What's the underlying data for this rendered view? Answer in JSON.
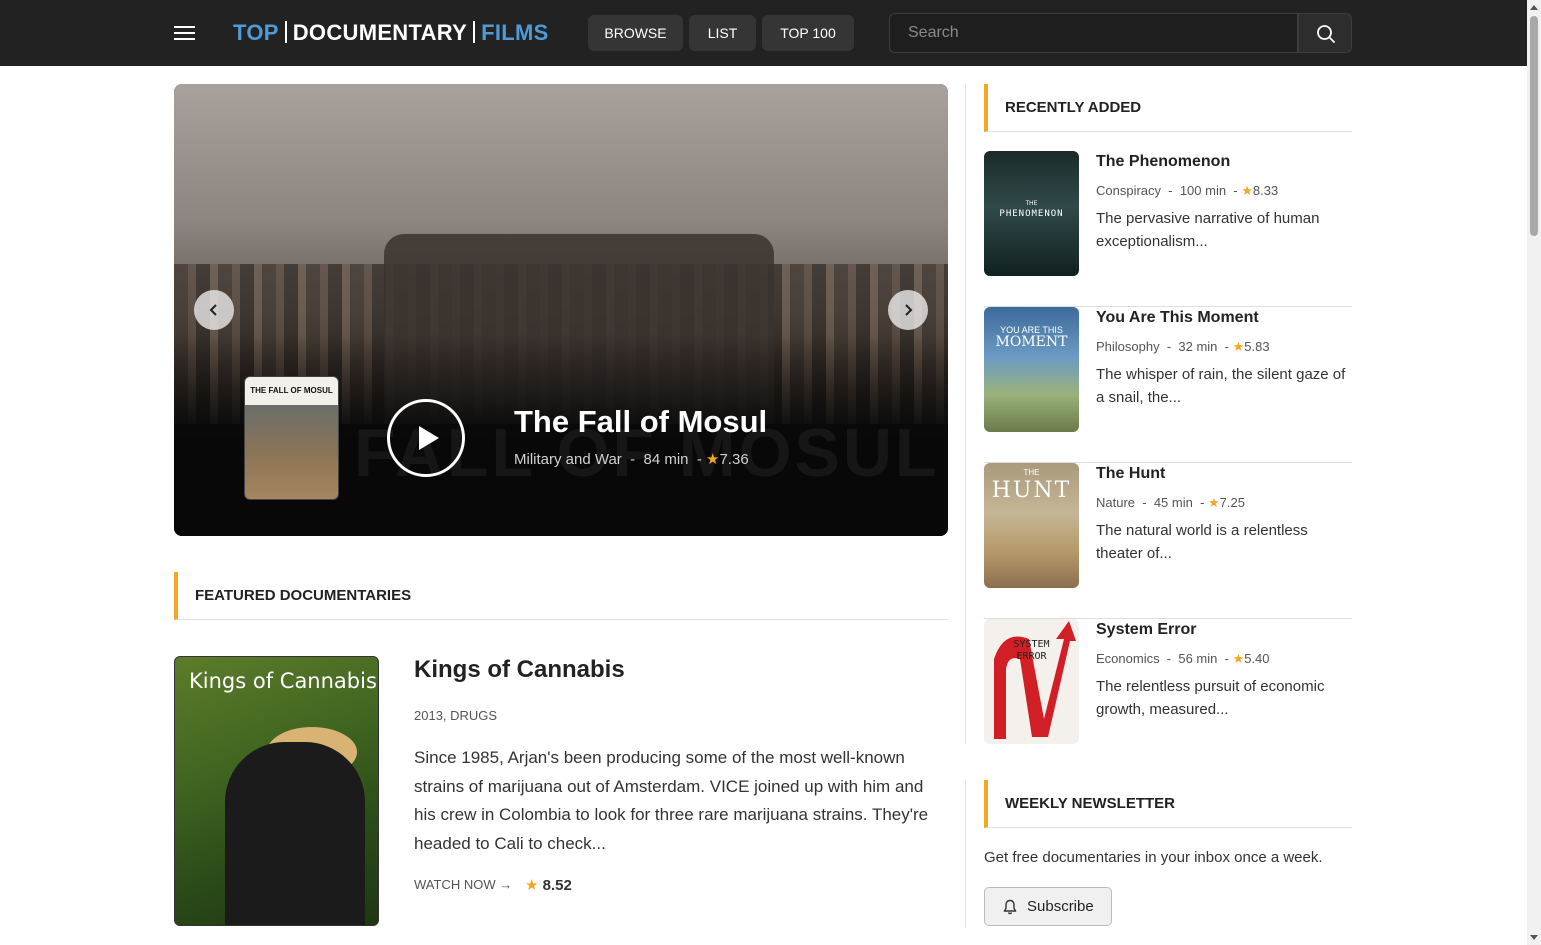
{
  "header": {
    "logo": {
      "part1": "TOP",
      "part2": "DOCUMENTARY",
      "part3": "FILMS"
    },
    "nav": {
      "browse": "BROWSE",
      "list": "LIST",
      "top100": "TOP 100"
    },
    "search_placeholder": "Search"
  },
  "hero": {
    "title": "The Fall of Mosul",
    "category": "Military and War",
    "duration": "84 min",
    "rating": "7.36",
    "poster_label": "THE FALL OF MOSUL",
    "watermark": "FALL OF MOSUL"
  },
  "featured": {
    "section_title": "FEATURED DOCUMENTARIES",
    "title": "Kings of Cannabis",
    "poster_label": "Kings of Cannabis",
    "year_category": "2013, DRUGS",
    "description": "Since 1985, Arjan's been producing some of the most well-known strains of marijuana out of Amsterdam. VICE joined up with him and his crew in Colombia to look for three rare marijuana strains. They're headed to Cali to check...",
    "watch_label": "WATCH NOW →",
    "rating": "8.52"
  },
  "recent": {
    "section_title": "RECENTLY ADDED",
    "items": [
      {
        "title": "The Phenomenon",
        "category": "Conspiracy",
        "duration": "100 min",
        "rating": "8.33",
        "description": "The pervasive narrative of human exceptionalism...",
        "poster_label": "PHENOMENON",
        "poster_small": "THE"
      },
      {
        "title": "You Are This Moment",
        "category": "Philosophy",
        "duration": "32 min",
        "rating": "5.83",
        "description": "The whisper of rain, the silent gaze of a snail, the...",
        "poster_label": "MOMENT",
        "poster_small": "YOU ARE THIS"
      },
      {
        "title": "The Hunt",
        "category": "Nature",
        "duration": "45 min",
        "rating": "7.25",
        "description": "The natural world is a relentless theater of...",
        "poster_label": "HUNT",
        "poster_small": "THE"
      },
      {
        "title": "System Error",
        "category": "Economics",
        "duration": "56 min",
        "rating": "5.40",
        "description": "The relentless pursuit of economic growth, measured...",
        "poster_label": "SYSTEM ERROR",
        "poster_small": ""
      }
    ]
  },
  "newsletter": {
    "section_title": "WEEKLY NEWSLETTER",
    "text": "Get free documentaries in your inbox once a week.",
    "button": "Subscribe"
  },
  "colors": {
    "accent": "#f5a623",
    "logo_blue": "#4f9bd7",
    "header_bg": "#222222"
  }
}
